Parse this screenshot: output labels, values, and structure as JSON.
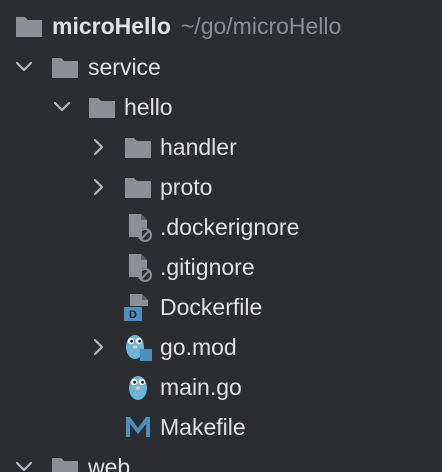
{
  "tree": {
    "root": {
      "name": "microHello",
      "path": "~/go/microHello",
      "icon": "folder-icon"
    },
    "service": {
      "name": "service",
      "expanded": true,
      "icon": "folder-icon"
    },
    "hello": {
      "name": "hello",
      "expanded": true,
      "icon": "folder-icon"
    },
    "handler": {
      "name": "handler",
      "expanded": false,
      "icon": "folder-icon"
    },
    "proto": {
      "name": "proto",
      "expanded": false,
      "icon": "folder-icon"
    },
    "dockerignore": {
      "name": ".dockerignore",
      "icon": "ignored-file-icon"
    },
    "gitignore": {
      "name": ".gitignore",
      "icon": "ignored-file-icon"
    },
    "dockerfile": {
      "name": "Dockerfile",
      "icon": "docker-file-icon"
    },
    "gomod": {
      "name": "go.mod",
      "expanded": false,
      "icon": "go-mod-icon"
    },
    "maingo": {
      "name": "main.go",
      "icon": "go-file-icon"
    },
    "makefile": {
      "name": "Makefile",
      "icon": "makefile-icon"
    },
    "web": {
      "name": "web",
      "expanded": true,
      "icon": "folder-icon"
    }
  },
  "colors": {
    "background": "#2b2d30",
    "text": "#dfe1e5",
    "muted": "#8b8e94",
    "folder": "#8c8f96",
    "accent_blue": "#4c8fbd"
  }
}
